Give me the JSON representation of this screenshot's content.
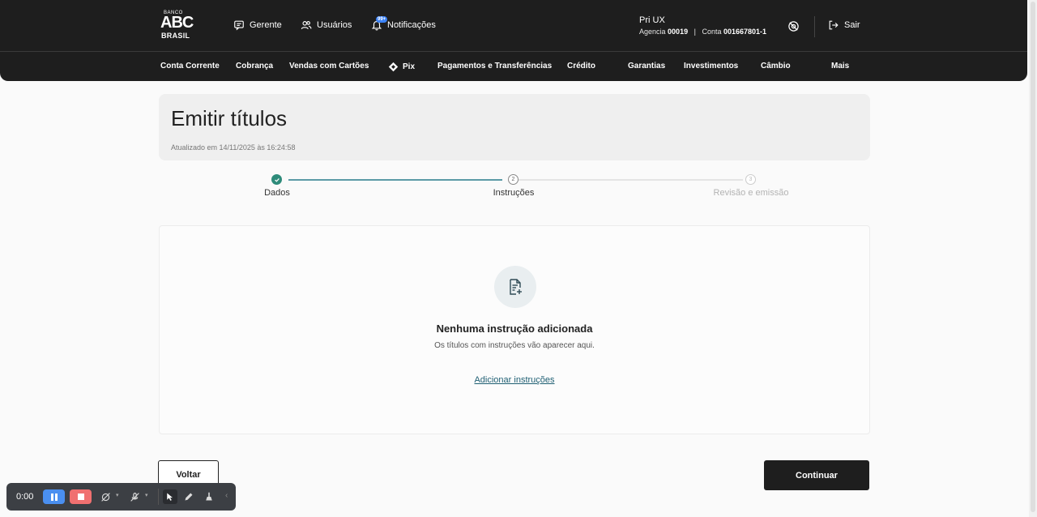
{
  "header": {
    "logo": {
      "top": "BANCO",
      "middle": "ABC",
      "bottom": "BRASIL"
    },
    "nav": [
      {
        "label": "Gerente",
        "icon": "chat-icon"
      },
      {
        "label": "Usuários",
        "icon": "users-icon"
      },
      {
        "label": "Notificações",
        "icon": "bell-icon",
        "badge": "99+"
      }
    ],
    "account": {
      "name": "Pri UX",
      "agency_label": "Agencia",
      "agency_number": "00019",
      "separator": "|",
      "account_label": "Conta",
      "account_number": "001667801-1"
    },
    "logout_label": "Sair"
  },
  "menu": [
    "Conta Corrente",
    "Cobrança",
    "Vendas com Cartões",
    "Pix",
    "Pagamentos e Transferências",
    "Crédito",
    "Garantias",
    "Investimentos",
    "Câmbio",
    "Mais"
  ],
  "page": {
    "title": "Emitir títulos",
    "updated": "Atualizado em 14/11/2025 às 16:24:58"
  },
  "stepper": {
    "steps": [
      {
        "label": "Dados",
        "number": "1",
        "state": "done"
      },
      {
        "label": "Instruções",
        "number": "2",
        "state": "current"
      },
      {
        "label": "Revisão e emissão",
        "number": "3",
        "state": "pending"
      }
    ]
  },
  "empty_state": {
    "icon": "document-add-icon",
    "title": "Nenhuma instrução adicionada",
    "subtitle": "Os títulos com instruções vão aparecer aqui.",
    "link": "Adicionar instruções"
  },
  "actions": {
    "back": "Voltar",
    "continue": "Continuar"
  },
  "recorder": {
    "time": "0:00"
  },
  "colors": {
    "dark": "#1e1e1e",
    "accent": "#2e8b7a",
    "link": "#1f5f73",
    "pause": "#4a8ff0",
    "stop": "#f07070"
  }
}
